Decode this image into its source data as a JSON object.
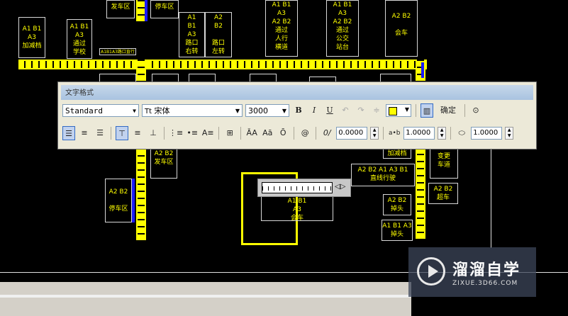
{
  "drawing": {
    "labels": {
      "top_left_1": "A1 B1\nA3\n加减档",
      "top_left_2": "A1 B1\nA3\n通过\n学校",
      "top_fache": "发车区",
      "top_tingche": "停车区",
      "top_mid_1": "A1\nB1\nA3\n路口\n右转",
      "top_mid_2": "A2\nB2\n\n路口\n左转",
      "top_renxing": "A1 B1\nA3\nA2 B2\n通过\n人行\n横道",
      "top_gongjiao": "A1 B1\nA3\nA2 B2\n通过\n公交\n站台",
      "top_huiche": "A2 B2\n\n会车",
      "small_tag": "A1B1A3路口直行",
      "fache_right": "A2 B2\n发车区",
      "tingche_left": "A2 B2\n\n停车区",
      "center_huiche": "A1 B1\nA3\n会车",
      "zhixian": "A2 B2 A1 A3 B1\n直线行驶",
      "diaotou_1": "A2 B2\n掉头",
      "diaotou_2": "A1 B1 A3\n掉头",
      "biandao": "变更\n车道",
      "chaoche": "A2 B2\n超车",
      "jiajian": "加减档"
    }
  },
  "toolbar": {
    "title": "文字格式",
    "style_value": "Standard",
    "font_icon": "Tt",
    "font_value": "宋体",
    "height_value": "3000",
    "bold_label": "B",
    "italic_label": "I",
    "underline_label": "U",
    "ok_label": "确定",
    "oblique_value": "0.0000",
    "tracking_value": "1.0000",
    "width_value": "1.0000",
    "oblique_icon": "0/",
    "tracking_icon": "a•b",
    "at_icon": "@",
    "uppercase_icon": "ĀA",
    "lowercase_icon": "Aā",
    "overline_icon": "Ō"
  },
  "watermark": {
    "title": "溜溜自学",
    "url": "ZIXUE.3D66.COM"
  },
  "colors": {
    "accent_yellow": "#ffff00",
    "blue_bar": "#1a1aff"
  }
}
